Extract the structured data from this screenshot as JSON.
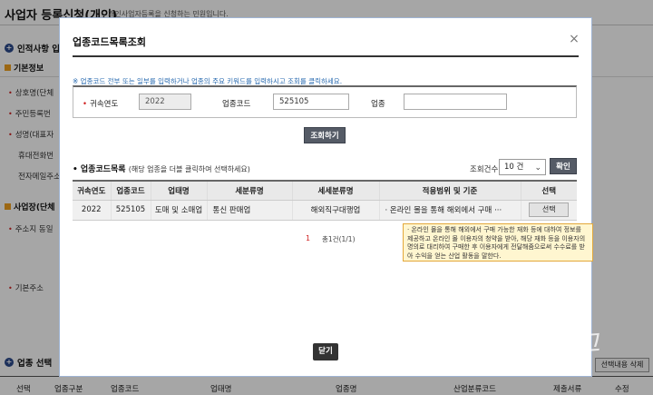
{
  "background": {
    "page_title": "사업자 등록신청(개인)",
    "page_subtitle": "개인사업자등록을 신청하는 민원입니다.",
    "section_personal": "인적사항 입",
    "section_personal_num": "+",
    "basic_info": "기본정보",
    "rows": [
      "상호명(단체",
      "주민등록번",
      "성명(대표자",
      "휴대전화번",
      "전자메일주소"
    ],
    "section_business": "사업장(단체",
    "address_row": "주소지 동일",
    "basic_address": "기본주소",
    "section_industry": "업종 선택",
    "delete_button": "선택내용 삭제",
    "footer_cols": [
      "선택",
      "업종구분",
      "업종코드",
      "업태명",
      "업종명",
      "산업분류코드",
      "제출서류",
      "수정"
    ]
  },
  "modal": {
    "title": "업종코드목록조회",
    "close_icon": "×",
    "help_text": "※ 업종코드 전부 또는 일부를 입력하거나 업종의 주요 키워드를 입력하시고 조회를 클릭하세요.",
    "search": {
      "year_label": "귀속연도",
      "year_value": "2022",
      "code_label": "업종코드",
      "code_value": "525105",
      "industry_label": "업종",
      "industry_value": ""
    },
    "search_button": "조회하기",
    "list_title": "업종코드목록",
    "list_hint": "(해당 업종을 더블 클릭하여 선택하세요)",
    "count_label": "조회건수",
    "count_value": "10 건",
    "confirm_button": "확인",
    "columns": [
      "귀속연도",
      "업종코드",
      "업태명",
      "세분류명",
      "세세분류명",
      "적용범위 및 기준",
      "선택"
    ],
    "rows": [
      {
        "year": "2022",
        "code": "525105",
        "business_type": "도매 및 소매업",
        "subclass": "통신 판매업",
        "detail_class": "해외직구대행업",
        "scope": "· 온라인 몰을 통해 해외에서 구매 ···",
        "select": "선택"
      }
    ],
    "pagination_current": "1",
    "pagination_total": "총1건(1/1)",
    "tooltip": "· 온라인 몰을 통해 해외에서 구매 가능한 재화 등에 대하여 정보를 제공하고 온라인 몰 이용자의 청약을 받아, 해당 재화 등을 이용자의 명의로 대리하여 구매한 후 이용자에게 전달해줌으로써 수수료를 받아 수익을 얻는 산업 활동을 말한다.",
    "close_button": "닫기"
  },
  "watermark": "제씨리그"
}
